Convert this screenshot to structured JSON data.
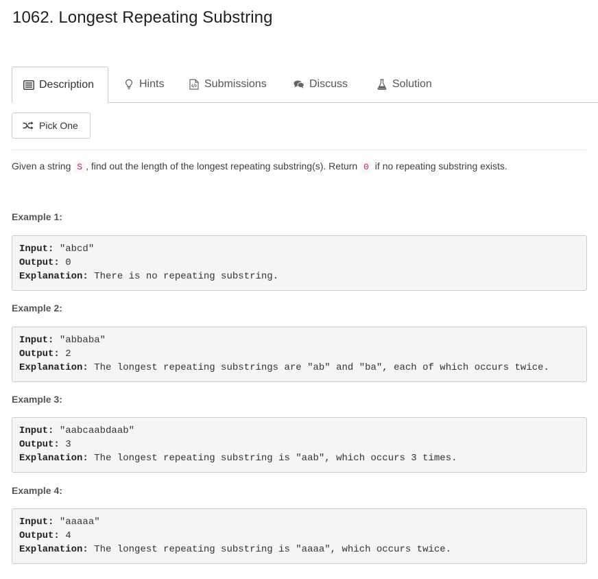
{
  "problem": {
    "title": "1062. Longest Repeating Substring"
  },
  "tabs": [
    {
      "label": "Description",
      "icon": "description-icon"
    },
    {
      "label": "Hints",
      "icon": "lightbulb-icon"
    },
    {
      "label": "Submissions",
      "icon": "code-file-icon"
    },
    {
      "label": "Discuss",
      "icon": "comments-icon"
    },
    {
      "label": "Solution",
      "icon": "flask-icon"
    }
  ],
  "pick_one": {
    "label": "Pick One",
    "icon": "shuffle-icon"
  },
  "description": {
    "part1": "Given a string ",
    "code1": "S",
    "part2": ", find out the length of the longest repeating substring(s). Return ",
    "code2": "0",
    "part3": " if no repeating substring exists."
  },
  "examples": [
    {
      "label": "Example 1:",
      "input_key": "Input:",
      "input_val": " \"abcd\"",
      "output_key": "Output:",
      "output_val": " 0",
      "explanation_key": "Explanation:",
      "explanation_val": " There is no repeating substring."
    },
    {
      "label": "Example 2:",
      "input_key": "Input:",
      "input_val": " \"abbaba\"",
      "output_key": "Output:",
      "output_val": " 2",
      "explanation_key": "Explanation:",
      "explanation_val": " The longest repeating substrings are \"ab\" and \"ba\", each of which occurs twice."
    },
    {
      "label": "Example 3:",
      "input_key": "Input:",
      "input_val": " \"aabcaabdaab\"",
      "output_key": "Output:",
      "output_val": " 3",
      "explanation_key": "Explanation:",
      "explanation_val": " The longest repeating substring is \"aab\", which occurs 3 times."
    },
    {
      "label": "Example 4:",
      "input_key": "Input:",
      "input_val": " \"aaaaa\"",
      "output_key": "Output:",
      "output_val": " 4",
      "explanation_key": "Explanation:",
      "explanation_val": " The longest repeating substring is \"aaaa\", which occurs twice."
    }
  ],
  "colors": {
    "inline_code": "#c7254e",
    "code_bg": "#f5f5f5",
    "border": "#cccccc"
  }
}
